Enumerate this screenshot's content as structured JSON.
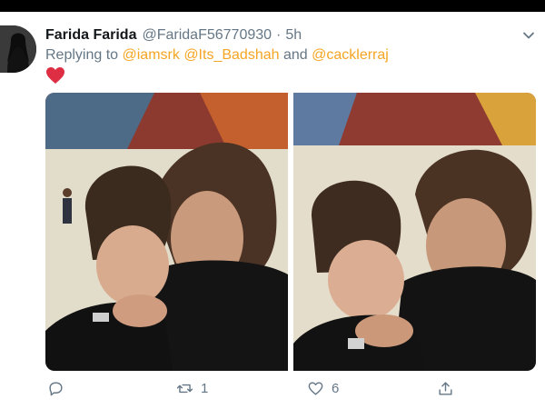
{
  "tweet": {
    "display_name": "Farida Farida",
    "handle": "@FaridaF56770930",
    "separator": "·",
    "time": "5h",
    "replying_prefix": "Replying to",
    "mentions": [
      "@iamsrk",
      "@Its_Badshah",
      "@cacklerraj"
    ],
    "mention_joiner_and": "and",
    "content_emoji": "red-heart-emoji"
  },
  "icons": {
    "menu": "chevron-down-icon",
    "reply": "reply-icon",
    "retweet": "retweet-icon",
    "like": "like-icon",
    "share": "share-icon"
  },
  "actions": {
    "reply_count": "",
    "retweet_count": "1",
    "like_count": "6",
    "share_count": ""
  },
  "colors": {
    "mention": "#f5a524",
    "secondary_text": "#657786",
    "heart": "#e0245e"
  },
  "media": {
    "photos": [
      "photo-1",
      "photo-2"
    ]
  }
}
